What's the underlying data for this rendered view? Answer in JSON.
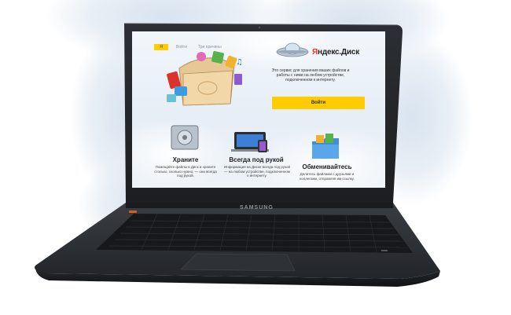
{
  "page": {
    "header": {
      "logo_text": "Я",
      "nav": [
        "Войти",
        "Три причины"
      ]
    },
    "brand": {
      "part1": "Я",
      "part2": "ндекс.Диск"
    },
    "description": "Это сервис для хранения ваших файлов и работы с ними на любом устройстве, подключенном к интернету.",
    "login_button": "Войти",
    "features": [
      {
        "title": "Храните",
        "text": "Помещайте файлы в Диск и храните столько, сколько нужно, — они всегда под рукой."
      },
      {
        "title": "Всегда под рукой",
        "text": "Информация на Диске всегда под рукой — на любом устройстве, подключенном к интернету."
      },
      {
        "title": "Обменивайтесь",
        "text": "Делитесь файлами с друзьями и коллегами, отправляя им ссылку."
      }
    ]
  },
  "device": {
    "brand": "SAMSUNG"
  },
  "colors": {
    "accent_yellow": "#ffcc00",
    "laptop_body": "#26292d",
    "background": "#ffffff"
  }
}
